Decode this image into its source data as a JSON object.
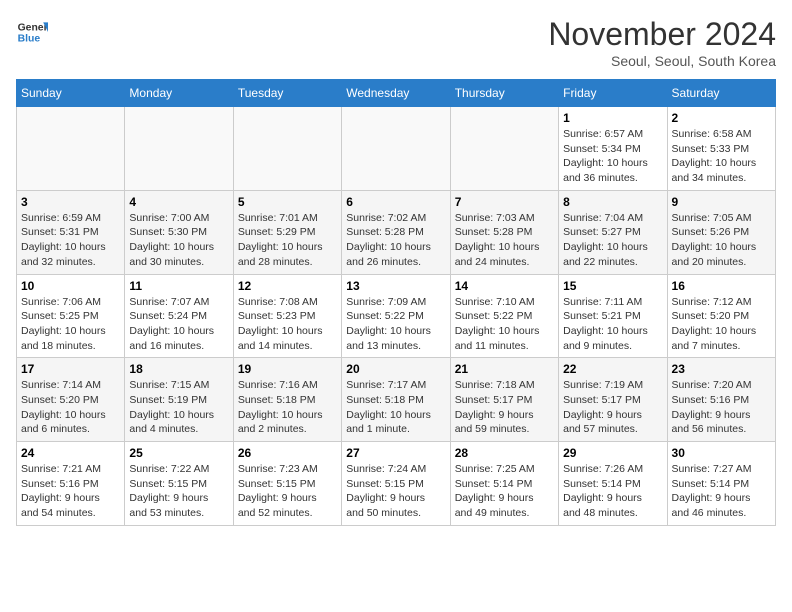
{
  "header": {
    "logo_line1": "General",
    "logo_line2": "Blue",
    "month": "November 2024",
    "location": "Seoul, Seoul, South Korea"
  },
  "days_of_week": [
    "Sunday",
    "Monday",
    "Tuesday",
    "Wednesday",
    "Thursday",
    "Friday",
    "Saturday"
  ],
  "weeks": [
    [
      {
        "day": "",
        "info": ""
      },
      {
        "day": "",
        "info": ""
      },
      {
        "day": "",
        "info": ""
      },
      {
        "day": "",
        "info": ""
      },
      {
        "day": "",
        "info": ""
      },
      {
        "day": "1",
        "info": "Sunrise: 6:57 AM\nSunset: 5:34 PM\nDaylight: 10 hours\nand 36 minutes."
      },
      {
        "day": "2",
        "info": "Sunrise: 6:58 AM\nSunset: 5:33 PM\nDaylight: 10 hours\nand 34 minutes."
      }
    ],
    [
      {
        "day": "3",
        "info": "Sunrise: 6:59 AM\nSunset: 5:31 PM\nDaylight: 10 hours\nand 32 minutes."
      },
      {
        "day": "4",
        "info": "Sunrise: 7:00 AM\nSunset: 5:30 PM\nDaylight: 10 hours\nand 30 minutes."
      },
      {
        "day": "5",
        "info": "Sunrise: 7:01 AM\nSunset: 5:29 PM\nDaylight: 10 hours\nand 28 minutes."
      },
      {
        "day": "6",
        "info": "Sunrise: 7:02 AM\nSunset: 5:28 PM\nDaylight: 10 hours\nand 26 minutes."
      },
      {
        "day": "7",
        "info": "Sunrise: 7:03 AM\nSunset: 5:28 PM\nDaylight: 10 hours\nand 24 minutes."
      },
      {
        "day": "8",
        "info": "Sunrise: 7:04 AM\nSunset: 5:27 PM\nDaylight: 10 hours\nand 22 minutes."
      },
      {
        "day": "9",
        "info": "Sunrise: 7:05 AM\nSunset: 5:26 PM\nDaylight: 10 hours\nand 20 minutes."
      }
    ],
    [
      {
        "day": "10",
        "info": "Sunrise: 7:06 AM\nSunset: 5:25 PM\nDaylight: 10 hours\nand 18 minutes."
      },
      {
        "day": "11",
        "info": "Sunrise: 7:07 AM\nSunset: 5:24 PM\nDaylight: 10 hours\nand 16 minutes."
      },
      {
        "day": "12",
        "info": "Sunrise: 7:08 AM\nSunset: 5:23 PM\nDaylight: 10 hours\nand 14 minutes."
      },
      {
        "day": "13",
        "info": "Sunrise: 7:09 AM\nSunset: 5:22 PM\nDaylight: 10 hours\nand 13 minutes."
      },
      {
        "day": "14",
        "info": "Sunrise: 7:10 AM\nSunset: 5:22 PM\nDaylight: 10 hours\nand 11 minutes."
      },
      {
        "day": "15",
        "info": "Sunrise: 7:11 AM\nSunset: 5:21 PM\nDaylight: 10 hours\nand 9 minutes."
      },
      {
        "day": "16",
        "info": "Sunrise: 7:12 AM\nSunset: 5:20 PM\nDaylight: 10 hours\nand 7 minutes."
      }
    ],
    [
      {
        "day": "17",
        "info": "Sunrise: 7:14 AM\nSunset: 5:20 PM\nDaylight: 10 hours\nand 6 minutes."
      },
      {
        "day": "18",
        "info": "Sunrise: 7:15 AM\nSunset: 5:19 PM\nDaylight: 10 hours\nand 4 minutes."
      },
      {
        "day": "19",
        "info": "Sunrise: 7:16 AM\nSunset: 5:18 PM\nDaylight: 10 hours\nand 2 minutes."
      },
      {
        "day": "20",
        "info": "Sunrise: 7:17 AM\nSunset: 5:18 PM\nDaylight: 10 hours\nand 1 minute."
      },
      {
        "day": "21",
        "info": "Sunrise: 7:18 AM\nSunset: 5:17 PM\nDaylight: 9 hours\nand 59 minutes."
      },
      {
        "day": "22",
        "info": "Sunrise: 7:19 AM\nSunset: 5:17 PM\nDaylight: 9 hours\nand 57 minutes."
      },
      {
        "day": "23",
        "info": "Sunrise: 7:20 AM\nSunset: 5:16 PM\nDaylight: 9 hours\nand 56 minutes."
      }
    ],
    [
      {
        "day": "24",
        "info": "Sunrise: 7:21 AM\nSunset: 5:16 PM\nDaylight: 9 hours\nand 54 minutes."
      },
      {
        "day": "25",
        "info": "Sunrise: 7:22 AM\nSunset: 5:15 PM\nDaylight: 9 hours\nand 53 minutes."
      },
      {
        "day": "26",
        "info": "Sunrise: 7:23 AM\nSunset: 5:15 PM\nDaylight: 9 hours\nand 52 minutes."
      },
      {
        "day": "27",
        "info": "Sunrise: 7:24 AM\nSunset: 5:15 PM\nDaylight: 9 hours\nand 50 minutes."
      },
      {
        "day": "28",
        "info": "Sunrise: 7:25 AM\nSunset: 5:14 PM\nDaylight: 9 hours\nand 49 minutes."
      },
      {
        "day": "29",
        "info": "Sunrise: 7:26 AM\nSunset: 5:14 PM\nDaylight: 9 hours\nand 48 minutes."
      },
      {
        "day": "30",
        "info": "Sunrise: 7:27 AM\nSunset: 5:14 PM\nDaylight: 9 hours\nand 46 minutes."
      }
    ]
  ]
}
